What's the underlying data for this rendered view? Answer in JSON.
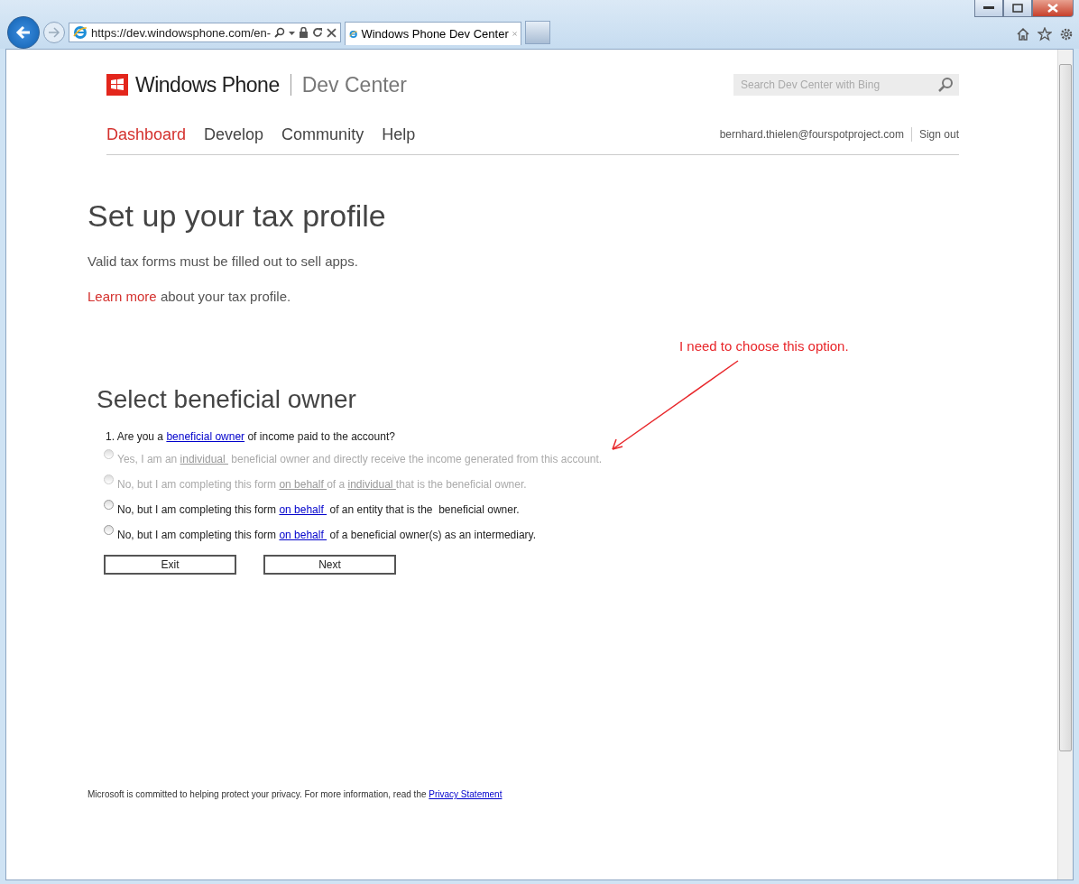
{
  "browser": {
    "address": "https://dev.windowsphone.com/en-",
    "tabs": [
      {
        "title": "Windows Phone Dev Center",
        "selected": true
      }
    ]
  },
  "header": {
    "brand": "Windows Phone",
    "section": "Dev Center",
    "search": {
      "placeholder": "Search Dev Center with Bing"
    },
    "nav": [
      {
        "label": "Dashboard",
        "selected": true
      },
      {
        "label": "Develop",
        "selected": false
      },
      {
        "label": "Community",
        "selected": false
      },
      {
        "label": "Help",
        "selected": false
      }
    ],
    "user": "bernhard.thielen@fourspotproject.com",
    "sign_out": "Sign out"
  },
  "page": {
    "title": "Set up your tax profile",
    "intro": "Valid tax forms must be filled out to sell apps.",
    "learn_more_link": "Learn more",
    "learn_more_rest": " about your tax profile."
  },
  "form": {
    "title": "Select beneficial owner",
    "question": [
      {
        "text": "1. Are you a ",
        "link": false
      },
      {
        "text": "beneficial owner",
        "link": true
      },
      {
        "text": " of income paid to the  account?",
        "link": false
      }
    ],
    "options": [
      {
        "selected": false,
        "disabled": true,
        "segments": [
          {
            "text": "Yes, I am an ",
            "link": false
          },
          {
            "text": "individual ",
            "link": true
          },
          {
            "text": " beneficial owner and directly receive the income generated from this account.",
            "link": false
          }
        ]
      },
      {
        "selected": false,
        "disabled": true,
        "segments": [
          {
            "text": "No, but I am completing this form ",
            "link": false
          },
          {
            "text": "on behalf ",
            "link": true
          },
          {
            "text": "of a ",
            "link": false
          },
          {
            "text": "individual ",
            "link": true
          },
          {
            "text": "that is the beneficial owner.",
            "link": false
          }
        ]
      },
      {
        "selected": false,
        "disabled": false,
        "segments": [
          {
            "text": "No, but I am completing this form ",
            "link": false
          },
          {
            "text": "on behalf ",
            "link": true
          },
          {
            "text": " of an entity that is the  beneficial owner.",
            "link": false
          }
        ]
      },
      {
        "selected": false,
        "disabled": false,
        "segments": [
          {
            "text": "No, but I am completing this form ",
            "link": false
          },
          {
            "text": "on behalf ",
            "link": true
          },
          {
            "text": " of a beneficial owner(s) as an intermediary.",
            "link": false
          }
        ]
      }
    ],
    "buttons": [
      "Exit",
      "Next"
    ]
  },
  "annotation": {
    "text": "I need to choose this option."
  },
  "footer": {
    "text": "Microsoft is committed to helping protect your privacy. For more information, read the ",
    "link": "Privacy Statement"
  }
}
